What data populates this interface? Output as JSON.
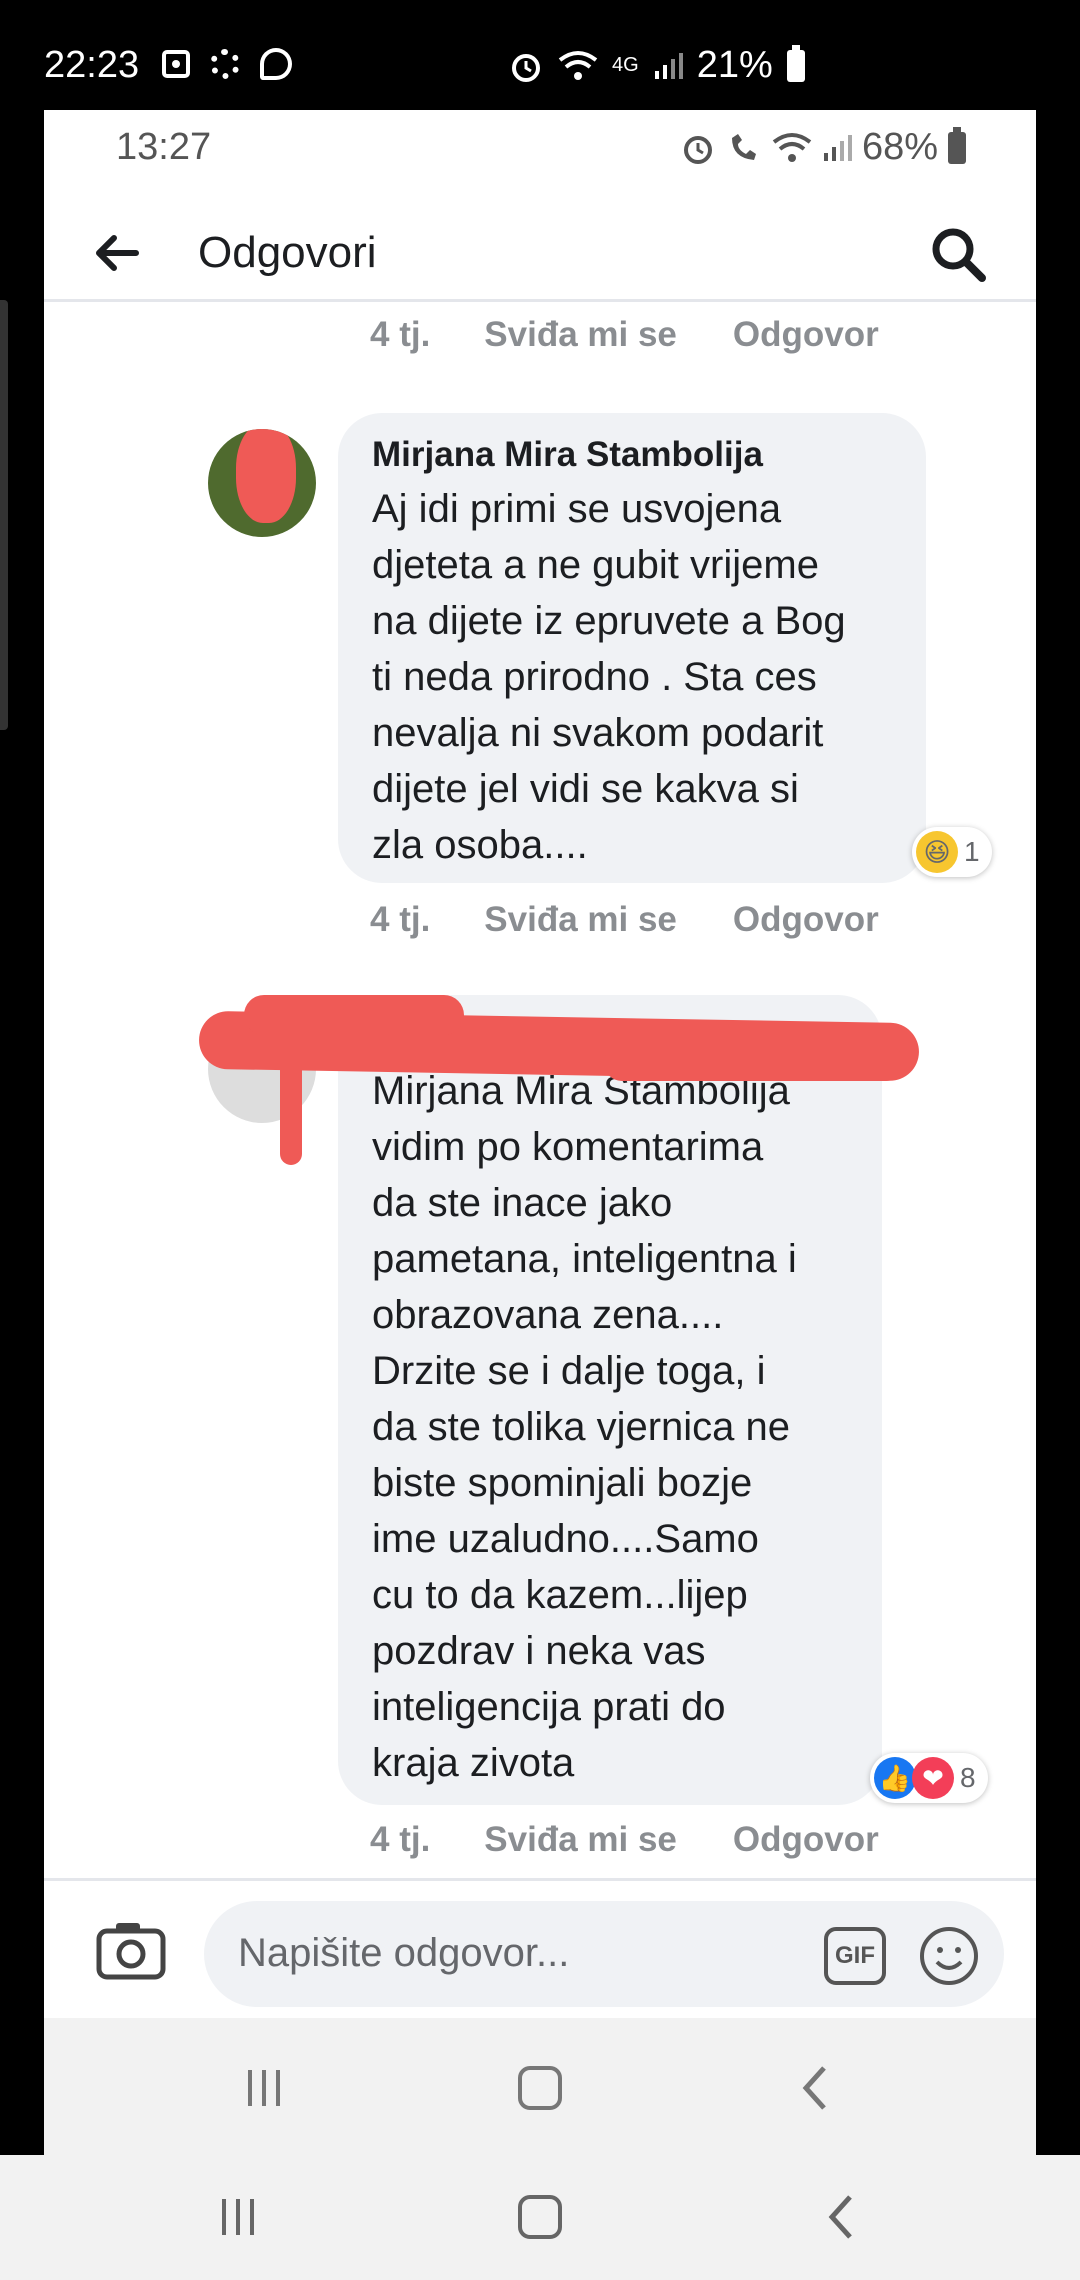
{
  "outer_status": {
    "time": "22:23",
    "network": "4G",
    "battery": "21%"
  },
  "inner_status": {
    "time": "13:27",
    "battery": "68%"
  },
  "header": {
    "title": "Odgovori"
  },
  "comments": [
    {
      "meta": {
        "age": "4 tj.",
        "like": "Sviđa mi se",
        "reply": "Odgovor"
      }
    },
    {
      "author": "Mirjana Mira Stambolija",
      "text": "Aj idi primi se usvojena\ndjeteta a ne gubit vrijeme\nna dijete iz epruvete a Bog\nti neda prirodno . Sta ces\nnevalja ni svakom podarit\ndijete   jel vidi se kakva si\nzla osoba....",
      "reaction_count": "1",
      "meta": {
        "age": "4 tj.",
        "like": "Sviđa mi se",
        "reply": "Odgovor"
      }
    },
    {
      "author": "",
      "text": "Mirjana Mira Stambolija\nvidim po komentarima\nda ste inace jako\npametana, inteligentna i\nobrazovana zena....\nDrzite se i dalje toga, i\nda ste tolika vjernica ne\nbiste spominjali bozje\nime uzaludno....Samo\ncu to da kazem...lijep\npozdrav i neka vas\ninteligencija prati do\nkraja zivota",
      "reaction_count": "8",
      "meta": {
        "age": "4 tj.",
        "like": "Sviđa mi se",
        "reply": "Odgovor"
      }
    }
  ],
  "composer": {
    "placeholder": "Napišite odgovor...",
    "gif_label": "GIF"
  },
  "icons": {
    "back": "arrow-left-icon",
    "search": "search-icon",
    "camera": "camera-icon",
    "smile": "smile-icon",
    "recents": "recents-icon",
    "home": "home-icon",
    "back_nav": "chevron-left-icon"
  },
  "colors": {
    "accent_like": "#1877f2",
    "love": "#f33e58",
    "haha": "#f7c62f",
    "redaction": "#ef5a56"
  }
}
